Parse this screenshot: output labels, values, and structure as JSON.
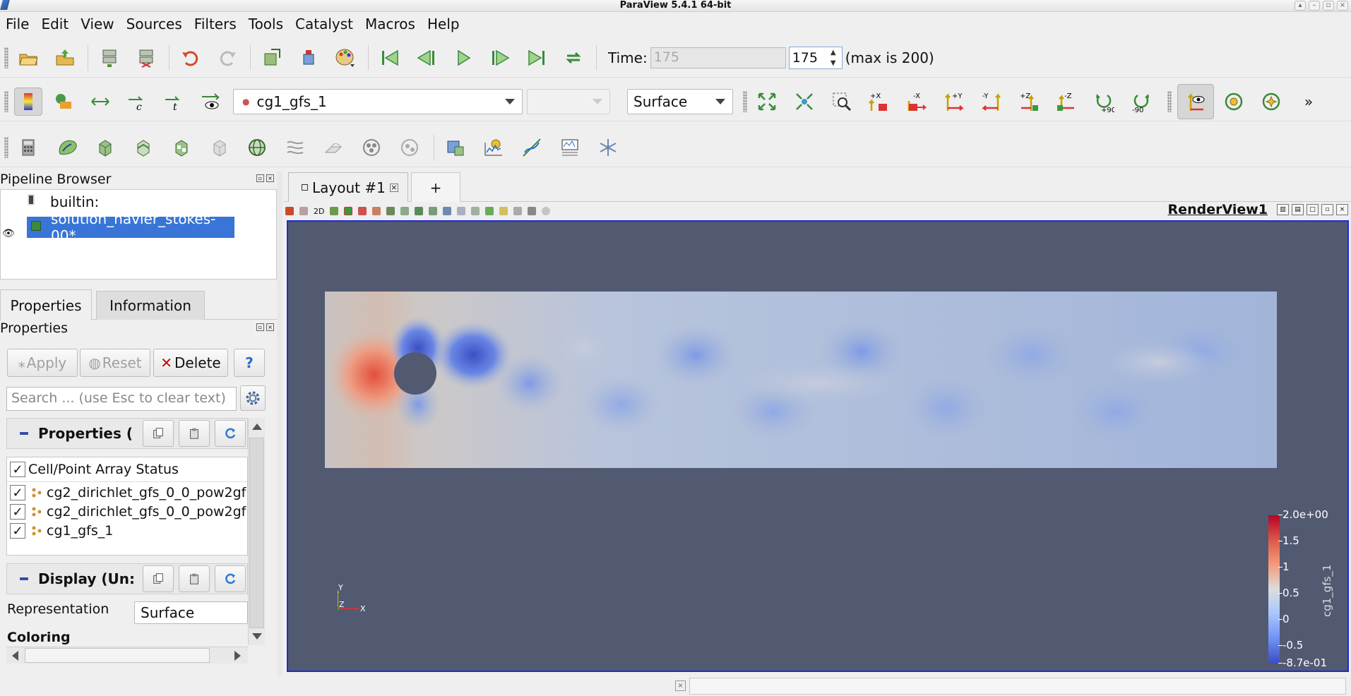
{
  "window": {
    "title": "ParaView 5.4.1 64-bit"
  },
  "menu": [
    "File",
    "Edit",
    "View",
    "Sources",
    "Filters",
    "Tools",
    "Catalyst",
    "Macros",
    "Help"
  ],
  "time_toolbar": {
    "label": "Time:",
    "time_value": "175",
    "step_value": "175",
    "max_text": "(max is 200)"
  },
  "representation_toolbar": {
    "array_selection": "cg1_gfs_1",
    "component_selection": "",
    "representation": "Surface"
  },
  "camera_buttons": {
    "plus90": "+90",
    "minus90": "-90",
    "more": "»"
  },
  "pipeline_browser": {
    "title": "Pipeline Browser",
    "items": [
      {
        "label": "builtin:"
      },
      {
        "label": "solution_navier_stokes-00*"
      }
    ]
  },
  "panel_tabs": [
    "Properties",
    "Information"
  ],
  "properties_panel": {
    "title": "Properties",
    "apply": "Apply",
    "reset": "Reset",
    "delete": "Delete",
    "help": "?",
    "search_placeholder": "Search ... (use Esc to clear text)",
    "properties_section": "Properties (",
    "array_header": "Cell/Point Array Status",
    "arrays": [
      {
        "name": "cg2_dirichlet_gfs_0_0_pow2gf",
        "checked": true
      },
      {
        "name": "cg2_dirichlet_gfs_0_0_pow2gf",
        "checked": true
      },
      {
        "name": "cg1_gfs_1",
        "checked": true
      }
    ],
    "display_section": "Display (Un:",
    "representation_label": "Representation",
    "representation_value": "Surface",
    "coloring_label": "Coloring"
  },
  "layout": {
    "tab_label": "Layout #1",
    "add_tab": "+",
    "render_view": "RenderView1",
    "mode_2d": "2D"
  },
  "colorbar": {
    "title": "cg1_gfs_1",
    "ticks": [
      "2.0e+00",
      "1.5",
      "1",
      "0.5",
      "0",
      "-0.5",
      "-8.7e-01"
    ]
  },
  "axes": {
    "x": "X",
    "y": "Y",
    "z": "Z"
  }
}
